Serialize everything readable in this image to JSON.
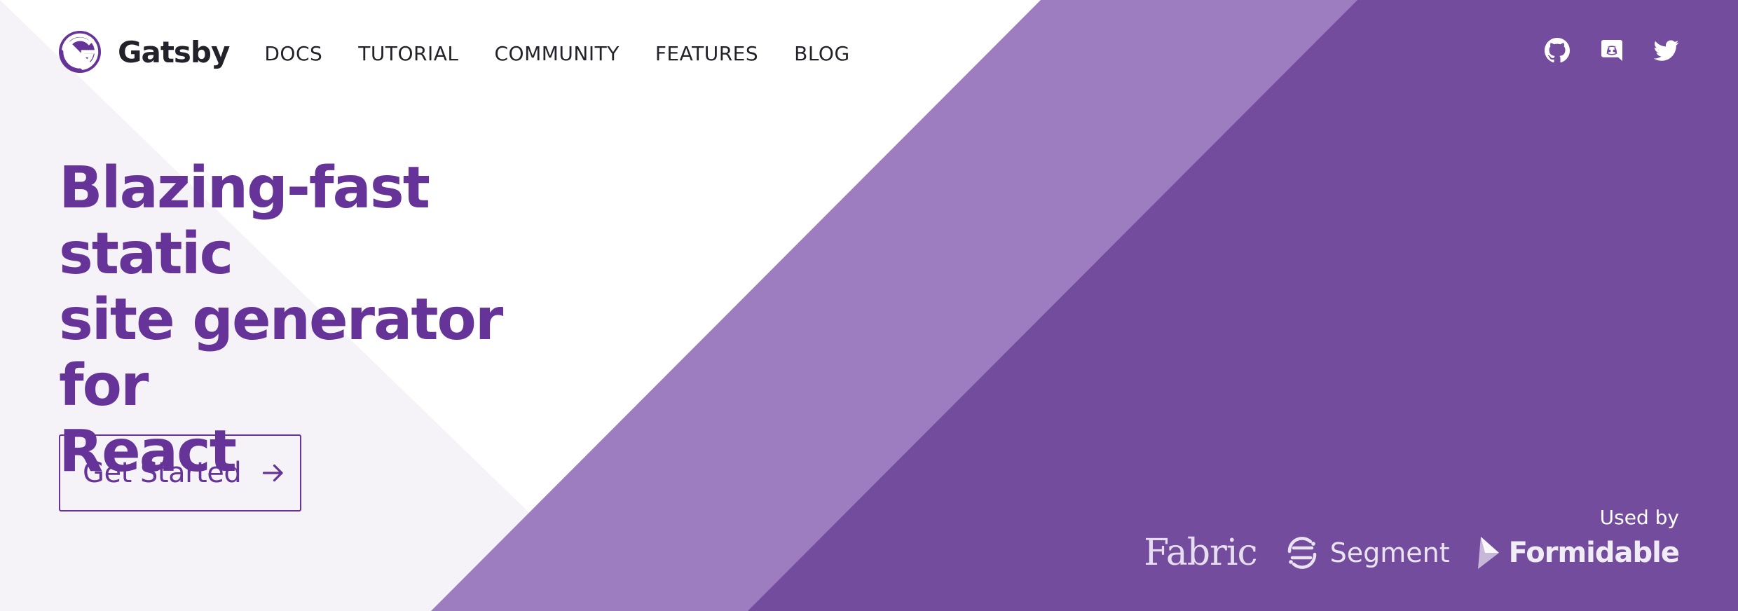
{
  "brand": {
    "name": "Gatsby",
    "logo_icon": "gatsby-logo-icon",
    "color": "#663399"
  },
  "nav": {
    "links": [
      "DOCS",
      "TUTORIAL",
      "COMMUNITY",
      "FEATURES",
      "BLOG"
    ]
  },
  "social": {
    "icons": [
      "github-icon",
      "discord-icon",
      "twitter-icon"
    ]
  },
  "hero": {
    "title_lines": [
      "Blazing-fast static",
      "site generator for",
      "React"
    ],
    "cta_label": "Get Started",
    "cta_icon": "arrow-right-icon"
  },
  "used_by": {
    "label": "Used by",
    "brands": [
      "Fabric",
      "Segment",
      "Formidable"
    ]
  },
  "colors": {
    "primary": "#663399",
    "light_purple": "#9d7cbf",
    "dark_purple": "#744c9e",
    "lavender": "#f5f3f7",
    "text": "#232129",
    "white": "#ffffff"
  }
}
